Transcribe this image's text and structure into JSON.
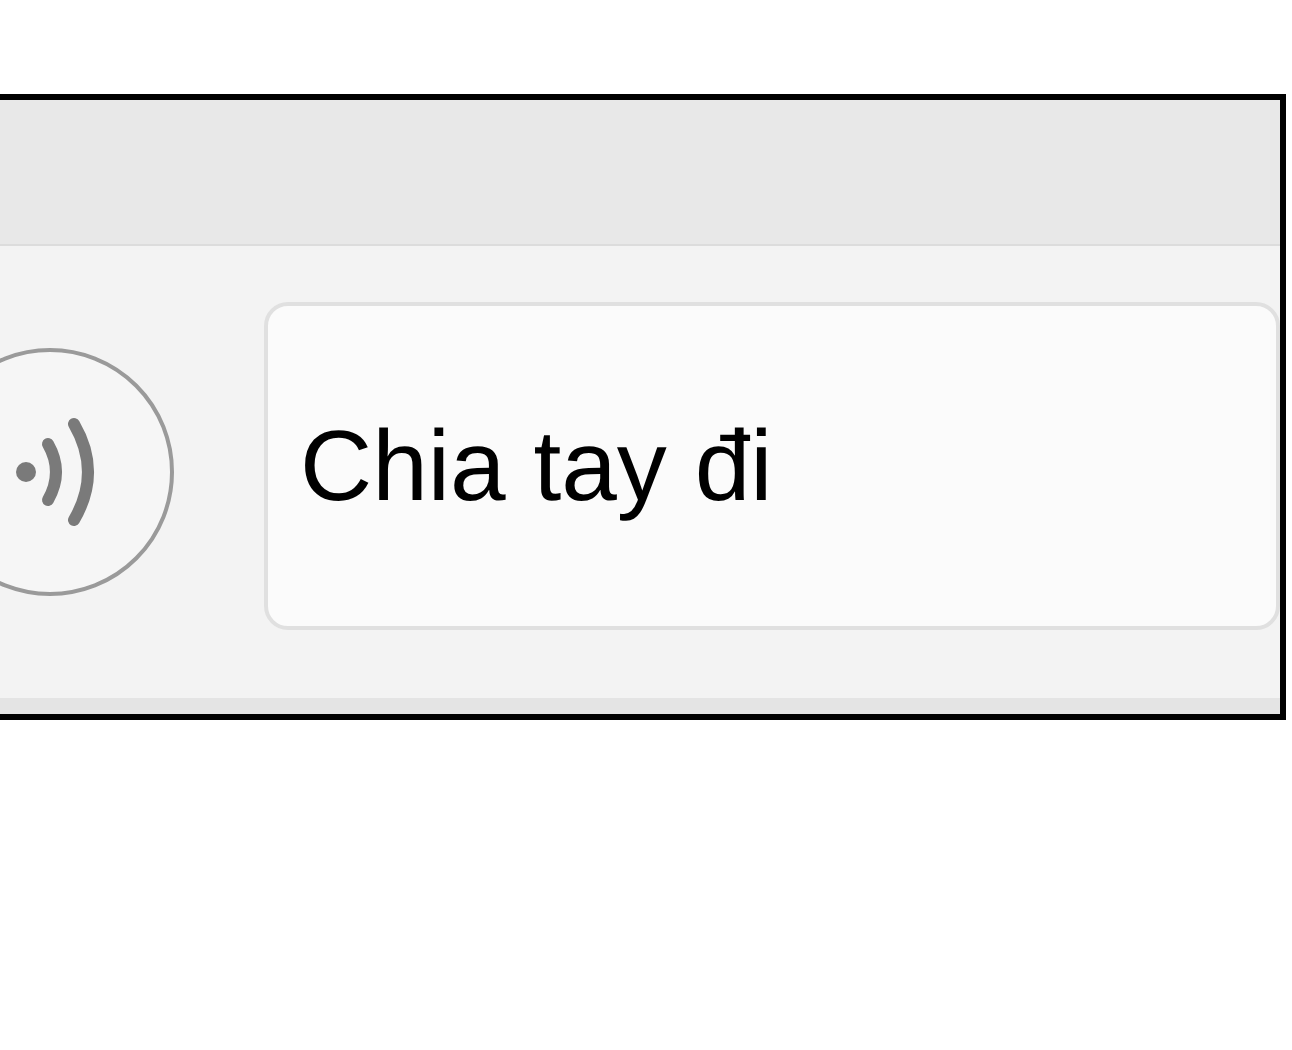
{
  "message_input": {
    "value": "Chia tay đi"
  }
}
